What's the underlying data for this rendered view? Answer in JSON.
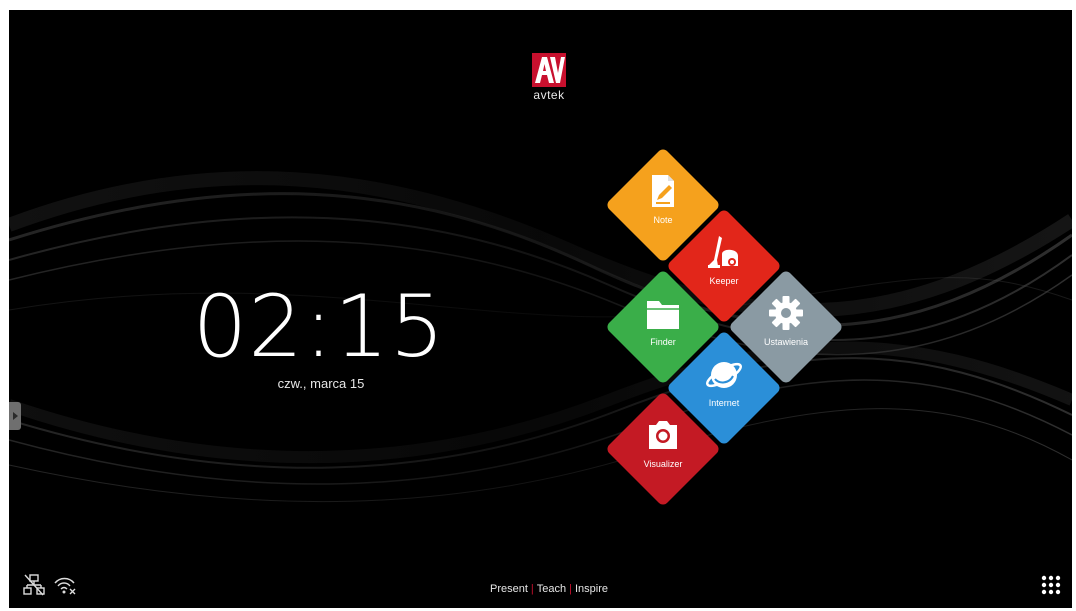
{
  "brand": {
    "logo_mark": "AV",
    "logo_text": "avtek"
  },
  "clock": {
    "time": "02:15",
    "date": "czw., marca 15"
  },
  "apps": [
    {
      "label": "Note",
      "icon": "note-pencil-icon",
      "color": "#f5a11d"
    },
    {
      "label": "Keeper",
      "icon": "vacuum-cleaner-icon",
      "color": "#e2261a"
    },
    {
      "label": "Finder",
      "icon": "folder-icon",
      "color": "#3aae49"
    },
    {
      "label": "Ustawienia",
      "icon": "gear-icon",
      "color": "#8a9aa3"
    },
    {
      "label": "Internet",
      "icon": "globe-icon",
      "color": "#2b8fd8"
    },
    {
      "label": "Visualizer",
      "icon": "camera-icon",
      "color": "#c41a24"
    }
  ],
  "tagline": {
    "present": "Present",
    "teach": "Teach",
    "inspire": "Inspire",
    "separator": "|"
  },
  "status_bar": {
    "network_icon": "ethernet-disconnected-icon",
    "wifi_icon": "wifi-off-icon"
  },
  "app_drawer_icon": "apps-grid-icon",
  "side_panel_icon": "side-panel-handle-icon"
}
